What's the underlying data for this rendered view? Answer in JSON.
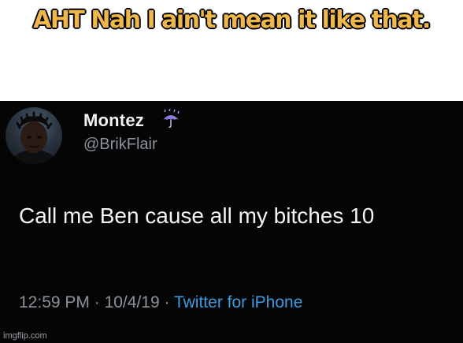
{
  "caption": "AHT Nah I ain't mean it like that.",
  "tweet": {
    "display_name": "Montez",
    "handle": "@BrikFlair",
    "text": "Call me Ben cause all my bitches 10",
    "time": "12:59 PM",
    "separator": "·",
    "date": "10/4/19",
    "source": "Twitter for iPhone",
    "name_icon": "umbrella-rain-icon"
  },
  "watermark": "imgflip.com",
  "colors": {
    "caption_fill": "#f0b84a",
    "tweet_bg": "#050505",
    "source_link": "#3d9be0",
    "meta_gray": "#8a939b"
  }
}
